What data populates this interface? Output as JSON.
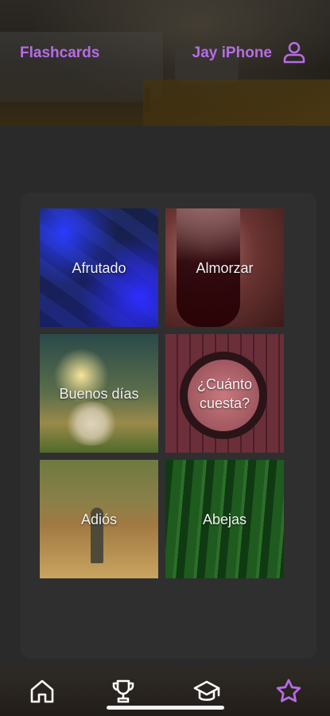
{
  "header": {
    "app_title": "Flashcards",
    "device_name": "Jay iPhone",
    "user_icon": "user-icon",
    "accent_color": "#b66ce6"
  },
  "cards": [
    {
      "label": "Afrutado"
    },
    {
      "label": "Almorzar"
    },
    {
      "label": "Buenos días"
    },
    {
      "label": "¿Cuánto cuesta?"
    },
    {
      "label": "Adiós"
    },
    {
      "label": "Abejas"
    }
  ],
  "bottom_nav": {
    "items": [
      {
        "icon": "home-icon"
      },
      {
        "icon": "trophy-icon"
      },
      {
        "icon": "graduation-cap-icon"
      },
      {
        "icon": "star-icon",
        "active": true
      }
    ],
    "active_color": "#b66ce6"
  }
}
